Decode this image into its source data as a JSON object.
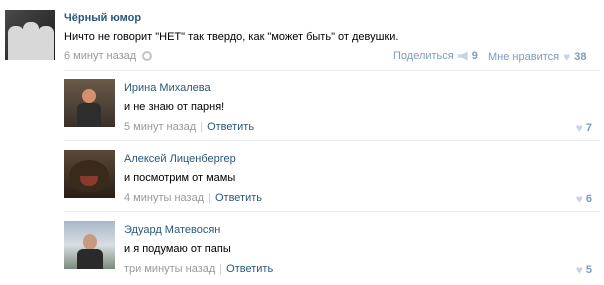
{
  "post": {
    "author": "Чёрный юмор",
    "text": "Ничто не говорит \"НЕТ\" так твердо, как \"может быть\" от девушки.",
    "time": "6 минут назад",
    "share_label": "Поделиться",
    "share_count": "9",
    "like_label": "Мне нравится",
    "like_count": "38"
  },
  "comments": [
    {
      "name": "Ирина Михалева",
      "text": "и не знаю от парня!",
      "time": "5 минут назад",
      "reply": "Ответить",
      "likes": "7"
    },
    {
      "name": "Алексей Лиценбергер",
      "text": "и посмотрим от мамы",
      "time": "4 минуты назад",
      "reply": "Ответить",
      "likes": "6"
    },
    {
      "name": "Эдуард Матевосян",
      "text": "и я подумаю от папы",
      "time": "три минуты назад",
      "reply": "Ответить",
      "likes": "5"
    }
  ],
  "icons": {
    "settings": "gear-icon",
    "share": "megaphone-icon",
    "like": "heart-icon"
  },
  "colors": {
    "link": "#2b587a",
    "muted": "#999999",
    "accent": "#7c9cbd"
  }
}
